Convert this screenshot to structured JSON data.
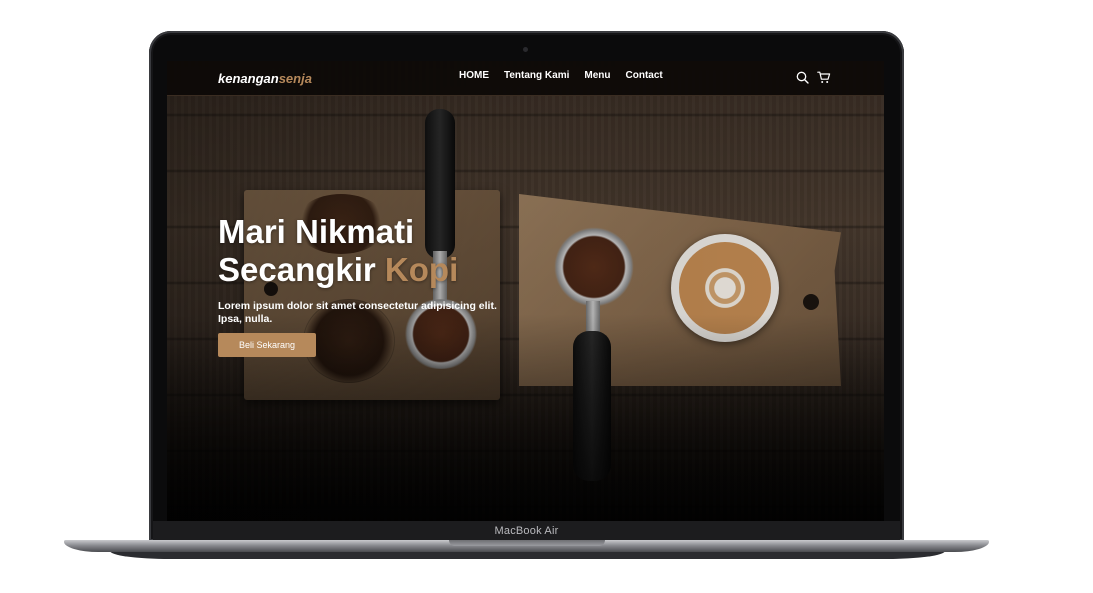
{
  "device": {
    "label": "MacBook Air"
  },
  "navbar": {
    "logo_main": "kenangan",
    "logo_accent": "senja",
    "links": [
      "HOME",
      "Tentang Kami",
      "Menu",
      "Contact"
    ],
    "icons": [
      "search-icon",
      "shopping-cart-icon"
    ]
  },
  "hero": {
    "title_line1": "Mari Nikmati",
    "title_line2": "Secangkir",
    "title_accent": "Kopi",
    "description": "Lorem ipsum dolor sit amet consectetur adipisicing elit. Ipsa, nulla.",
    "cta_label": "Beli Sekarang"
  },
  "colors": {
    "accent": "#b6895b",
    "navbar_bg": "#0c0907",
    "text": "#ffffff"
  }
}
